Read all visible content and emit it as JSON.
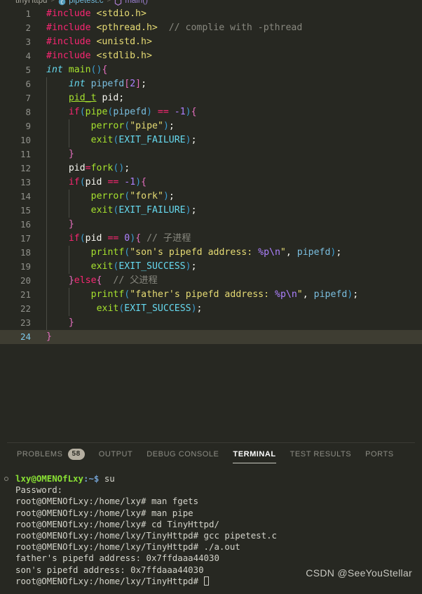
{
  "breadcrumb": {
    "project": "tinyHttpd",
    "file": "pipetest.c",
    "symbol": "main()",
    "sep": ">"
  },
  "editor": {
    "language": "c",
    "active_line": 24,
    "colors": {
      "background": "#272822",
      "active_line_background": "#3e3d32",
      "line_number": "#90918b",
      "keyword": "#f92672",
      "string": "#e6db74",
      "function": "#a6e22e",
      "type": "#66d9ef",
      "number": "#ae81ff",
      "comment": "#88887f"
    },
    "lines": [
      {
        "n": 1,
        "text": "#include <stdio.h>"
      },
      {
        "n": 2,
        "text": "#include <pthread.h>  // complie with -pthread"
      },
      {
        "n": 3,
        "text": "#include <unistd.h>"
      },
      {
        "n": 4,
        "text": "#include <stdlib.h>"
      },
      {
        "n": 5,
        "text": "int main(){"
      },
      {
        "n": 6,
        "text": "    int pipefd[2];"
      },
      {
        "n": 7,
        "text": "    pid_t pid;"
      },
      {
        "n": 8,
        "text": "    if(pipe(pipefd) == -1){"
      },
      {
        "n": 9,
        "text": "        perror(\"pipe\");"
      },
      {
        "n": 10,
        "text": "        exit(EXIT_FAILURE);"
      },
      {
        "n": 11,
        "text": "    }"
      },
      {
        "n": 12,
        "text": "    pid=fork();"
      },
      {
        "n": 13,
        "text": "    if(pid == -1){"
      },
      {
        "n": 14,
        "text": "        perror(\"fork\");"
      },
      {
        "n": 15,
        "text": "        exit(EXIT_FAILURE);"
      },
      {
        "n": 16,
        "text": "    }"
      },
      {
        "n": 17,
        "text": "    if(pid == 0){ // 子进程"
      },
      {
        "n": 18,
        "text": "        printf(\"son's pipefd address: %p\\n\", pipefd);"
      },
      {
        "n": 19,
        "text": "        exit(EXIT_SUCCESS);"
      },
      {
        "n": 20,
        "text": "    }else{  // 父进程"
      },
      {
        "n": 21,
        "text": "        printf(\"father's pipefd address: %p\\n\", pipefd);"
      },
      {
        "n": 22,
        "text": "         exit(EXIT_SUCCESS);"
      },
      {
        "n": 23,
        "text": "    }"
      },
      {
        "n": 24,
        "text": "}"
      }
    ]
  },
  "panel": {
    "tabs": [
      {
        "label": "PROBLEMS",
        "badge": "58",
        "active": false
      },
      {
        "label": "OUTPUT",
        "badge": null,
        "active": false
      },
      {
        "label": "DEBUG CONSOLE",
        "badge": null,
        "active": false
      },
      {
        "label": "TERMINAL",
        "badge": null,
        "active": true
      },
      {
        "label": "TEST RESULTS",
        "badge": null,
        "active": false
      },
      {
        "label": "PORTS",
        "badge": null,
        "active": false
      }
    ]
  },
  "terminal": {
    "lines": [
      {
        "prompt_user": "lxy@OMENOfLxy",
        "prompt_path": ":~$",
        "command": " su",
        "bullet": true
      },
      {
        "plain": "Password:"
      },
      {
        "plain": "root@OMENOfLxy:/home/lxy# man fgets"
      },
      {
        "plain": "root@OMENOfLxy:/home/lxy# man pipe"
      },
      {
        "plain": "root@OMENOfLxy:/home/lxy# cd TinyHttpd/"
      },
      {
        "plain": "root@OMENOfLxy:/home/lxy/TinyHttpd# gcc pipetest.c"
      },
      {
        "plain": "root@OMENOfLxy:/home/lxy/TinyHttpd# ./a.out"
      },
      {
        "plain": "father's pipefd address: 0x7ffdaaa44030"
      },
      {
        "plain": "son's pipefd address: 0x7ffdaaa44030"
      },
      {
        "plain": "root@OMENOfLxy:/home/lxy/TinyHttpd# ",
        "cursor": true
      }
    ]
  },
  "watermark": "CSDN @SeeYouStellar"
}
